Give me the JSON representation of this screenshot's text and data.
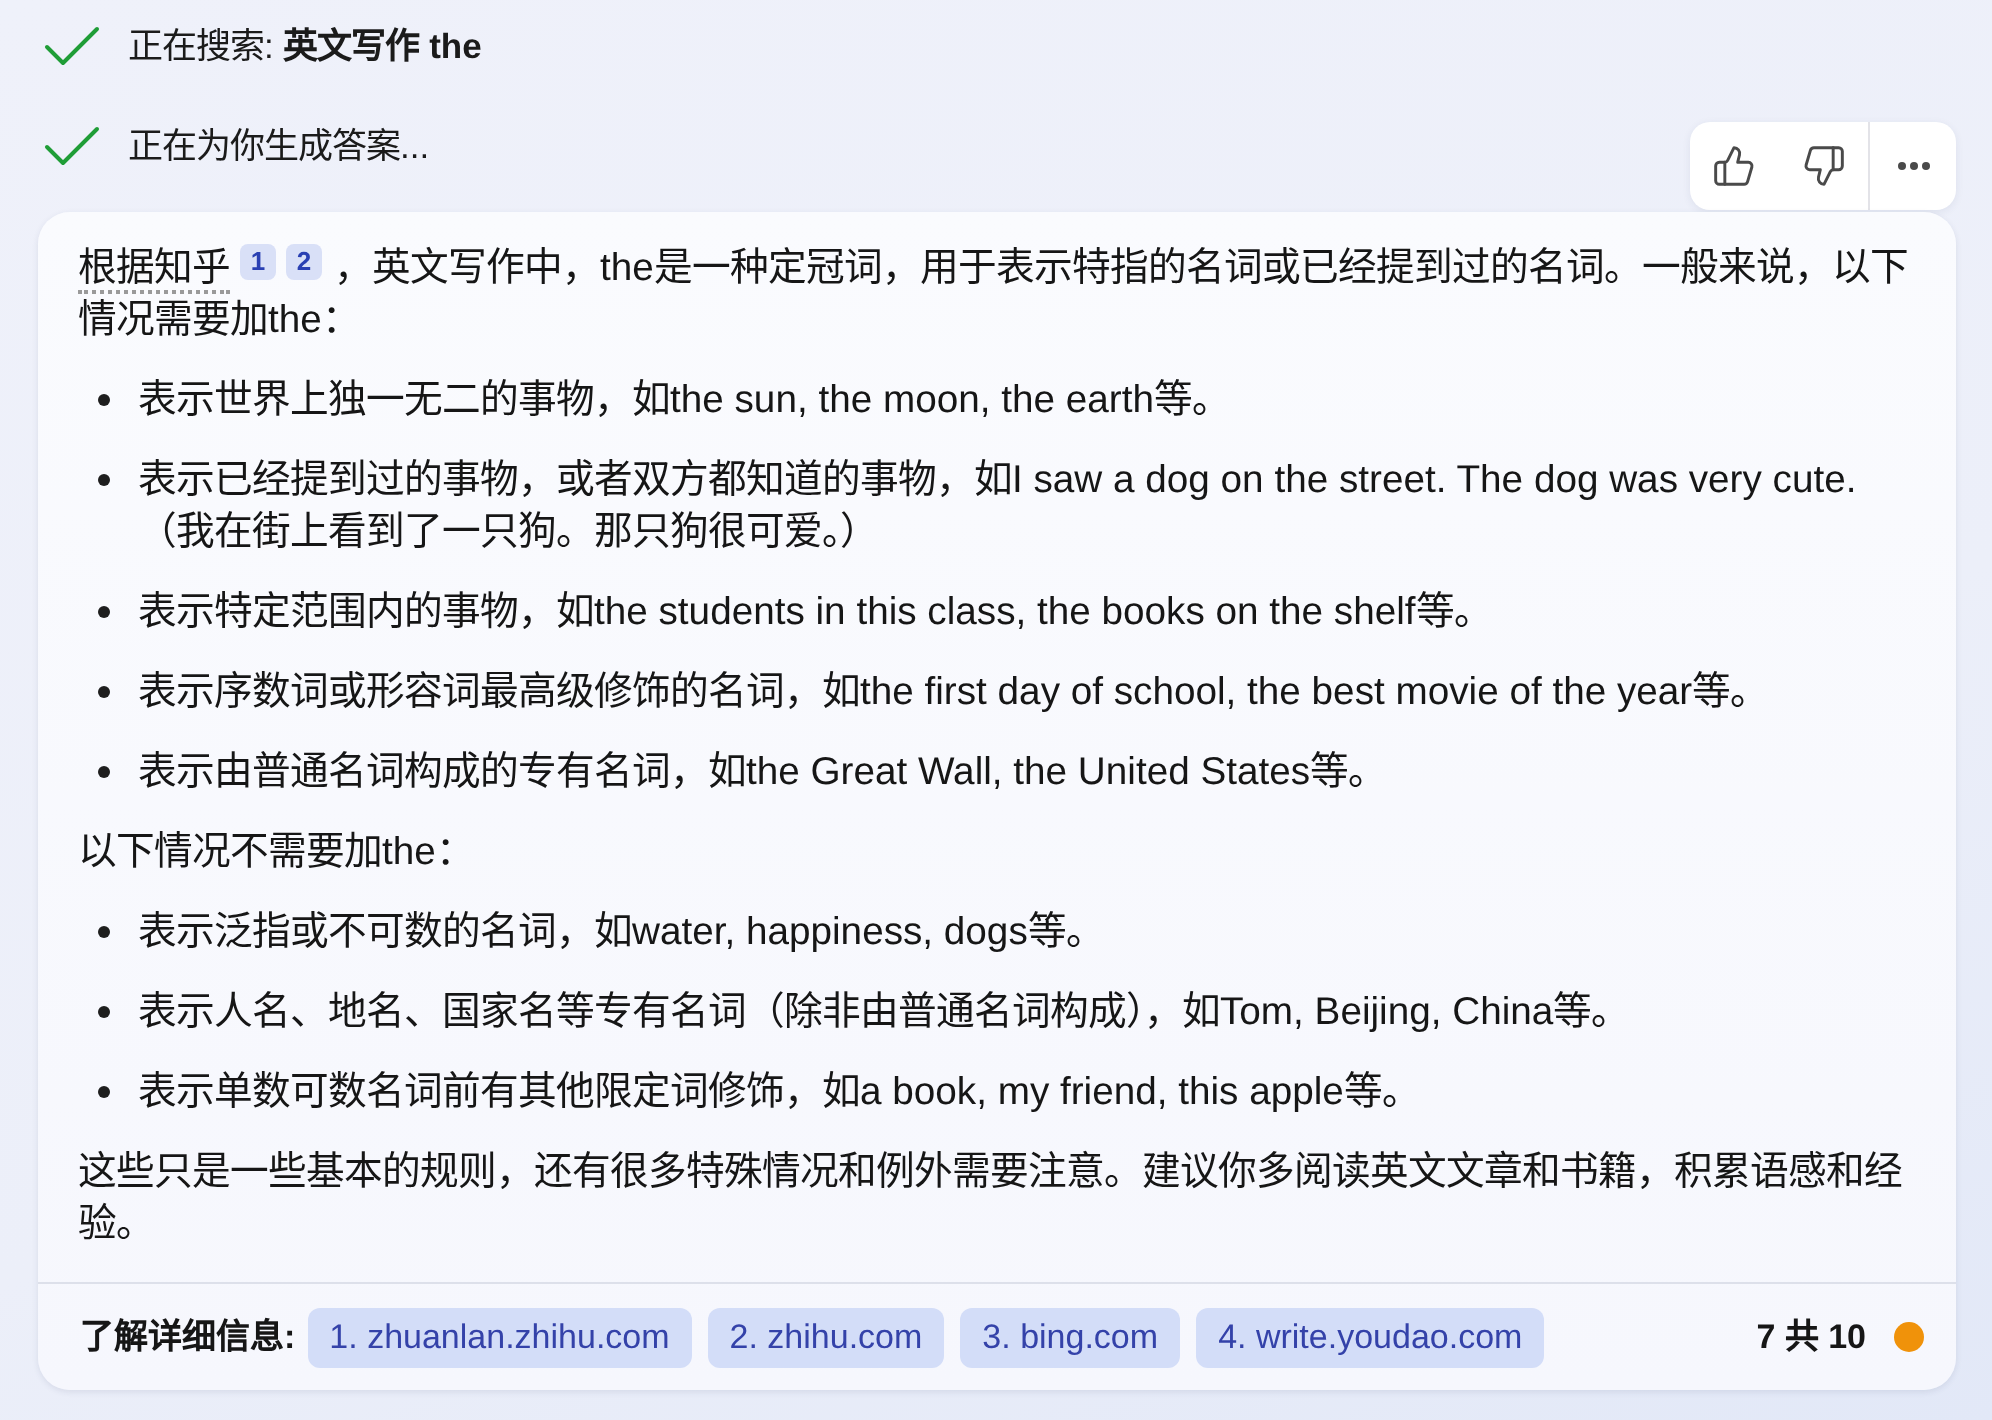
{
  "status_lines": [
    {
      "text": "正在搜索: **英文写作 the**"
    },
    {
      "text": "正在为你生成答案..."
    }
  ],
  "answer": {
    "blocks": [
      {
        "kind": "cited_paragraph",
        "source": "根据知乎",
        "citations": [
          "1",
          "2"
        ],
        "text": "，英文写作中，the是一种定冠词，用于表示特指的名词或已经提到过的名词。一般来说，以下情况需要加the："
      },
      {
        "kind": "bullets",
        "items": [
          "表示世界上独一无二的事物，如the sun, the moon, the earth等。",
          "表示已经提到过的事物，或者双方都知道的事物，如I saw a dog on the street. The dog was very cute.（我在街上看到了一只狗。那只狗很可爱。）",
          "表示特定范围内的事物，如the students in this class, the books on the shelf等。",
          "表示序数词或形容词最高级修饰的名词，如the first day of school, the best movie of the year等。",
          "表示由普通名词构成的专有名词，如the Great Wall, the United States等。"
        ]
      },
      {
        "kind": "paragraph",
        "text": "以下情况不需要加the："
      },
      {
        "kind": "bullets",
        "items": [
          "表示泛指或不可数的名词，如water, happiness, dogs等。",
          "表示人名、地名、国家名等专有名词（除非由普通名词构成），如Tom, Beijing, China等。",
          "表示单数可数名词前有其他限定词修饰，如a book, my friend, this apple等。"
        ]
      },
      {
        "kind": "paragraph",
        "text": "这些只是一些基本的规则，还有很多特殊情况和例外需要注意。建议你多阅读英文文章和书籍，积累语感和经验。"
      }
    ]
  },
  "footer": {
    "label": "了解详细信息:",
    "links": [
      "1. zhuanlan.zhihu.com",
      "2. zhihu.com",
      "3. bing.com",
      "4. write.youdao.com"
    ],
    "counter": "7 共 10"
  }
}
